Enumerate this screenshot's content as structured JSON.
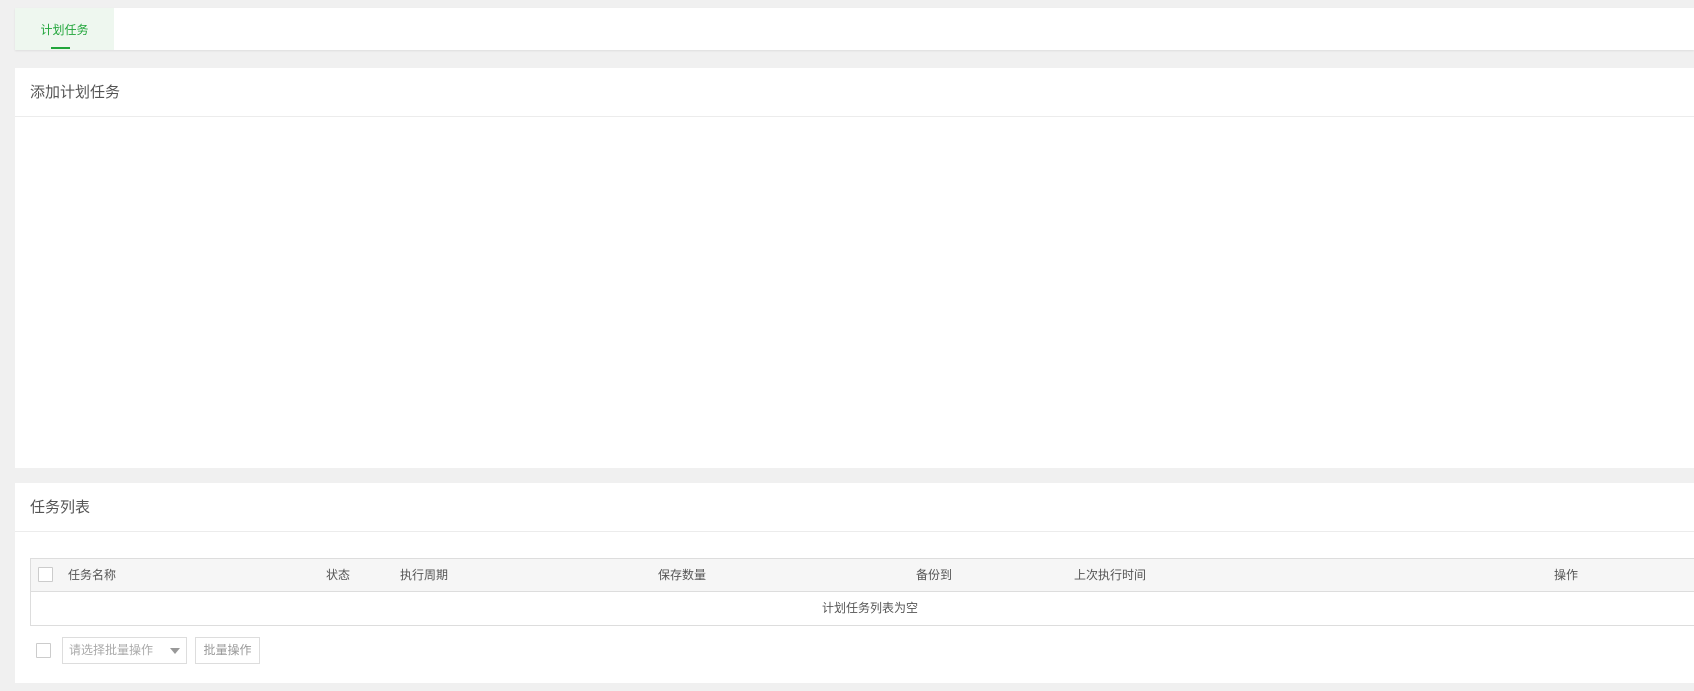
{
  "tabs": [
    {
      "label": "计划任务",
      "active": true
    }
  ],
  "add_panel": {
    "title": "添加计划任务"
  },
  "list_panel": {
    "title": "任务列表",
    "columns": [
      "任务名称",
      "状态",
      "执行周期",
      "保存数量",
      "备份到",
      "上次执行时间",
      "操作"
    ],
    "empty_text": "计划任务列表为空",
    "batch_select_placeholder": "请选择批量操作",
    "batch_button_label": "批量操作"
  },
  "colors": {
    "accent": "#20a53a",
    "tab_bg": "#eef7ef"
  },
  "icons": {
    "dropdown": "caret-down-icon"
  }
}
